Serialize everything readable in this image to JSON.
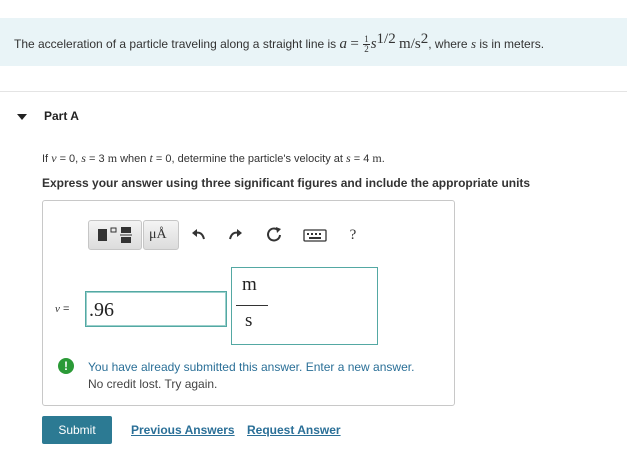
{
  "problem": {
    "intro": "The acceleration of a particle traveling along a straight line is",
    "accel_var": "a",
    "equals": "=",
    "frac_num": "1",
    "frac_den": "2",
    "s_var": "s",
    "exponent": "1/2",
    "units_base": "m/s",
    "units_exp": "2",
    "where_text": ", where",
    "s_var2": "s",
    "tail": "is in meters."
  },
  "part": {
    "title": "Part A"
  },
  "question": {
    "if_text": "If",
    "v_var": "v",
    "eq0": "= 0,",
    "s_var": "s",
    "eq3": "= 3",
    "m_unit": "m",
    "when": "when",
    "t_var": "t",
    "eq_t0": "= 0, determine the particle's velocity at",
    "s_var2": "s",
    "eq4": "= 4",
    "m_unit2": "m",
    "period": "."
  },
  "instruction": "Express your answer using three significant figures and include the appropriate units",
  "toolbar": {
    "templates_icon": "templates-icon",
    "units_label": "μÅ",
    "undo_icon": "undo-icon",
    "redo_icon": "redo-icon",
    "reset_icon": "reset-icon",
    "keyboard_icon": "keyboard-icon",
    "help_label": "?"
  },
  "answer": {
    "var_label": "v",
    "equals": "=",
    "value": ".96",
    "unit_numerator": "m",
    "unit_denominator": "s"
  },
  "alert": {
    "icon": "!",
    "line1": "You have already submitted this answer. Enter a new answer.",
    "line2": "No credit lost. Try again."
  },
  "actions": {
    "submit": "Submit",
    "previous_answers": "Previous Answers",
    "request_answer": "Request Answer"
  },
  "colors": {
    "banner_bg": "#e9f4f7",
    "submit_bg": "#2c7a93",
    "link": "#2a6f97",
    "input_border": "#53a8a3",
    "alert_green": "#2b9a37"
  }
}
